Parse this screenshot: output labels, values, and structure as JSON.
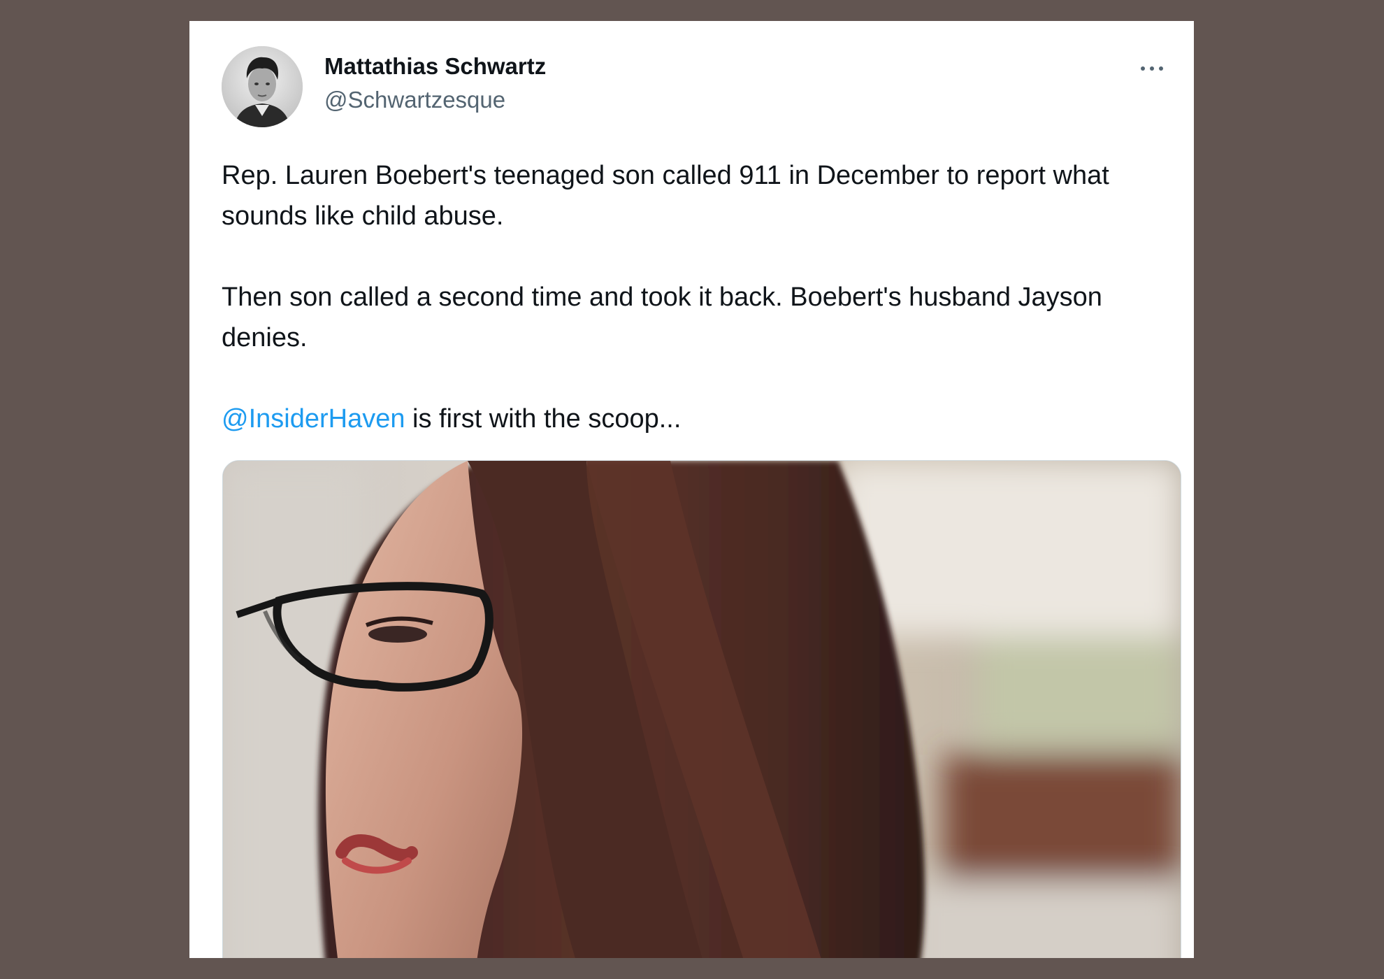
{
  "tweet": {
    "author": {
      "name": "Mattathias Schwartz",
      "handle": "@Schwartzesque"
    },
    "more_icon": "more-horizontal-icon",
    "text": {
      "paragraph1": "Rep. Lauren Boebert's teenaged son called 911 in December to report what sounds like child abuse.",
      "paragraph2": "Then son called a second time and took it back. Boebert's husband Jayson denies.",
      "mention": "@InsiderHaven",
      "paragraph3_rest": " is first with the scoop..."
    },
    "colors": {
      "background": "#625551",
      "card": "#ffffff",
      "text": "#0f1419",
      "secondary_text": "#536471",
      "link": "#1d9bf0"
    }
  }
}
